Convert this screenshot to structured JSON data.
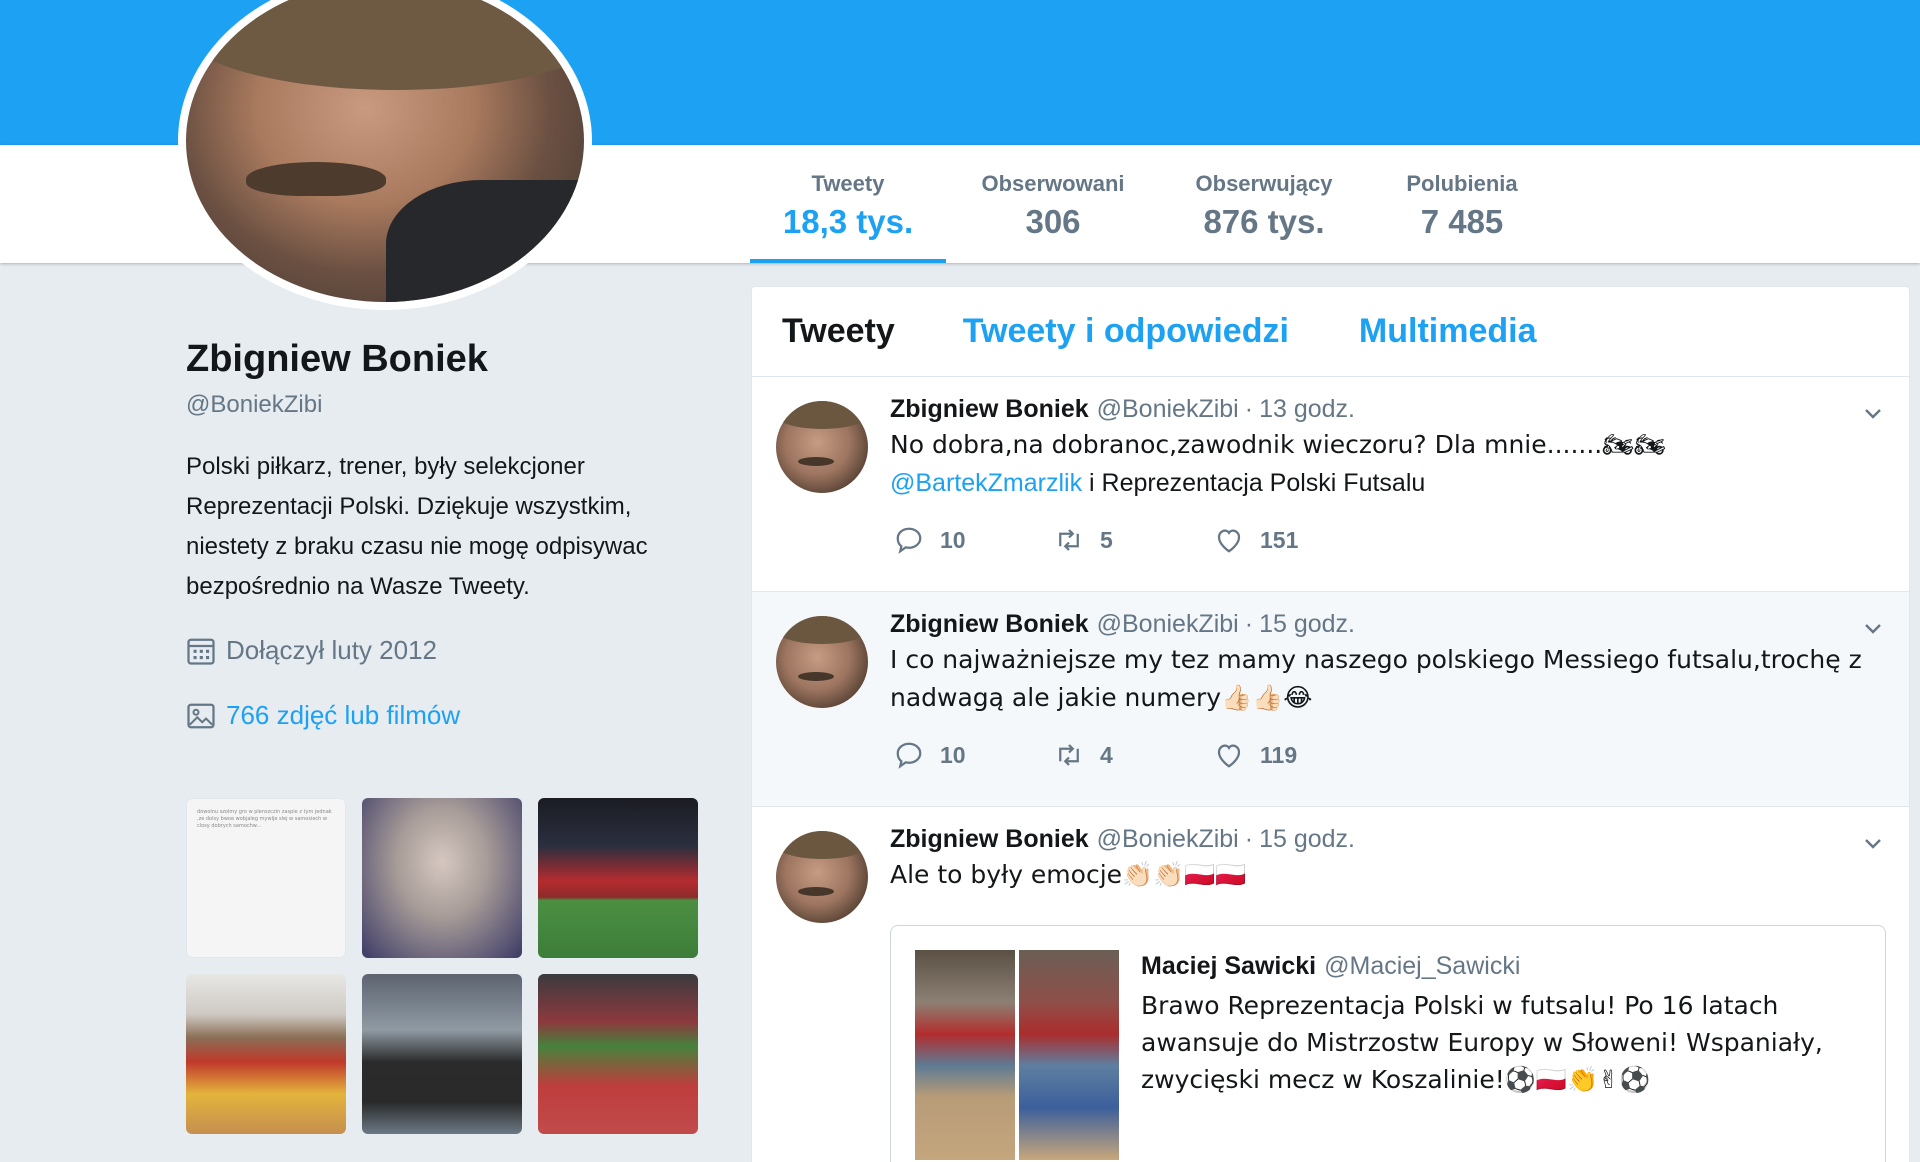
{
  "profile": {
    "name": "Zbigniew Boniek",
    "handle": "@BoniekZibi",
    "bio": "Polski piłkarz, trener, były selekcjoner Reprezentacji Polski. Dziękuje wszystkim, niestety z braku czasu nie mogę odpisywac bezpośrednio na Wasze Tweety.",
    "joined": "Dołączył luty 2012",
    "media_link": "766 zdjęć lub filmów",
    "thumb1_text": "dowolnu szolmy gro w plenszczin zaspie z tym jednak ,ze dolsy bwoe wobjaleg mywlje slej w samosiech w closy dobrych samochw...",
    "colors": {
      "accent": "#1da1f2",
      "muted": "#657786",
      "text": "#14171a",
      "background": "#e6ecf0"
    }
  },
  "stats": [
    {
      "label": "Tweety",
      "value": "18,3 tys."
    },
    {
      "label": "Obserwowani",
      "value": "306"
    },
    {
      "label": "Obserwujący",
      "value": "876 tys."
    },
    {
      "label": "Polubienia",
      "value": "7 485"
    }
  ],
  "tabs": [
    "Tweety",
    "Tweety i odpowiedzi",
    "Multimedia"
  ],
  "tweets": [
    {
      "name": "Zbigniew Boniek",
      "handle": "@BoniekZibi",
      "time": "13 godz.",
      "text_line1": "No dobra,na dobranoc,zawodnik wieczoru? Dla mnie.......🏍🏍",
      "mention": "@BartekZmarzlik",
      "text_line2": " i Reprezentacja Polski Futsalu",
      "replies": "10",
      "retweets": "5",
      "likes": "151"
    },
    {
      "name": "Zbigniew Boniek",
      "handle": "@BoniekZibi",
      "time": "15 godz.",
      "text": "I co najważniejsze my tez mamy naszego polskiego Messiego futsalu,trochę z nadwagą ale jakie numery👍🏻👍🏻😂",
      "replies": "10",
      "retweets": "4",
      "likes": "119"
    },
    {
      "name": "Zbigniew Boniek",
      "handle": "@BoniekZibi",
      "time": "15 godz.",
      "text": "Ale to były emocje👏🏻👏🏻🇵🇱🇵🇱",
      "quote": {
        "name": "Maciej Sawicki",
        "handle": "@Maciej_Sawicki",
        "text": "Brawo Reprezentacja Polski w futsalu! Po 16 latach awansuje do Mistrzostw Europy w Słoweni! Wspaniały, zwycięski mecz w Koszalinie!⚽🇵🇱👏✌⚽"
      }
    }
  ],
  "separator": "·",
  "icons": [
    "calendar-icon",
    "image-icon",
    "chevron-down-icon",
    "reply-icon",
    "retweet-icon",
    "like-icon"
  ]
}
